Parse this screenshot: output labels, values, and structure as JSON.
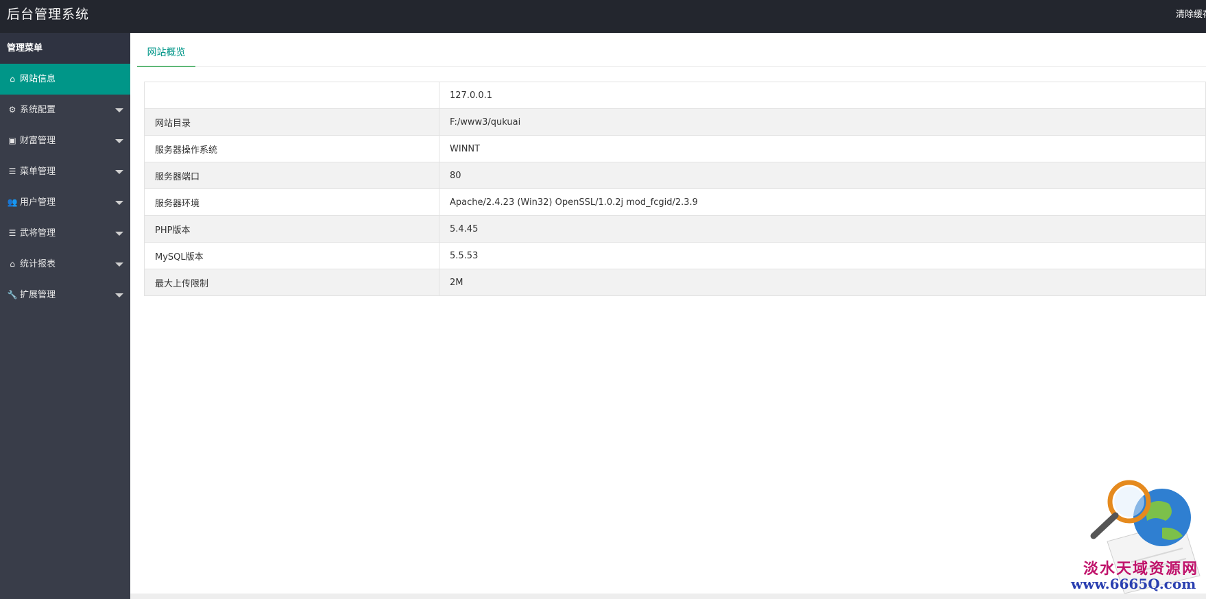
{
  "header": {
    "title": "后台管理系统",
    "right_link": "清除缓存"
  },
  "sidebar": {
    "title": "管理菜单",
    "items": [
      {
        "label": "网站信息",
        "icon": "home-icon",
        "glyph": "⌂",
        "active": true,
        "has_caret": false
      },
      {
        "label": "系统配置",
        "icon": "gears-icon",
        "glyph": "⚙",
        "active": false,
        "has_caret": true
      },
      {
        "label": "财富管理",
        "icon": "money-icon",
        "glyph": "▣",
        "active": false,
        "has_caret": true
      },
      {
        "label": "菜单管理",
        "icon": "list-icon",
        "glyph": "☰",
        "active": false,
        "has_caret": true
      },
      {
        "label": "用户管理",
        "icon": "users-icon",
        "glyph": "👥",
        "active": false,
        "has_caret": true
      },
      {
        "label": "武将管理",
        "icon": "list-icon",
        "glyph": "☰",
        "active": false,
        "has_caret": true
      },
      {
        "label": "统计报表",
        "icon": "home-icon",
        "glyph": "⌂",
        "active": false,
        "has_caret": true
      },
      {
        "label": "扩展管理",
        "icon": "wrench-icon",
        "glyph": "🔧",
        "active": false,
        "has_caret": true
      }
    ]
  },
  "main": {
    "tab_label": "网站概览",
    "rows": [
      {
        "label": "",
        "value": "127.0.0.1"
      },
      {
        "label": "网站目录",
        "value": "F:/www3/qukuai"
      },
      {
        "label": "服务器操作系统",
        "value": "WINNT"
      },
      {
        "label": "服务器端口",
        "value": "80"
      },
      {
        "label": "服务器环境",
        "value": "Apache/2.4.23 (Win32) OpenSSL/1.0.2j mod_fcgid/2.3.9"
      },
      {
        "label": "PHP版本",
        "value": "5.4.45"
      },
      {
        "label": "MySQL版本",
        "value": "5.5.53"
      },
      {
        "label": "最大上传限制",
        "value": "2M"
      }
    ]
  },
  "watermark": {
    "text": "淡水天域资源网",
    "url": "www.6665Q.com"
  },
  "colors": {
    "header_bg": "#23262e",
    "sidebar_bg": "#393d49",
    "accent": "#009688",
    "tab_underline": "#5fb878"
  }
}
